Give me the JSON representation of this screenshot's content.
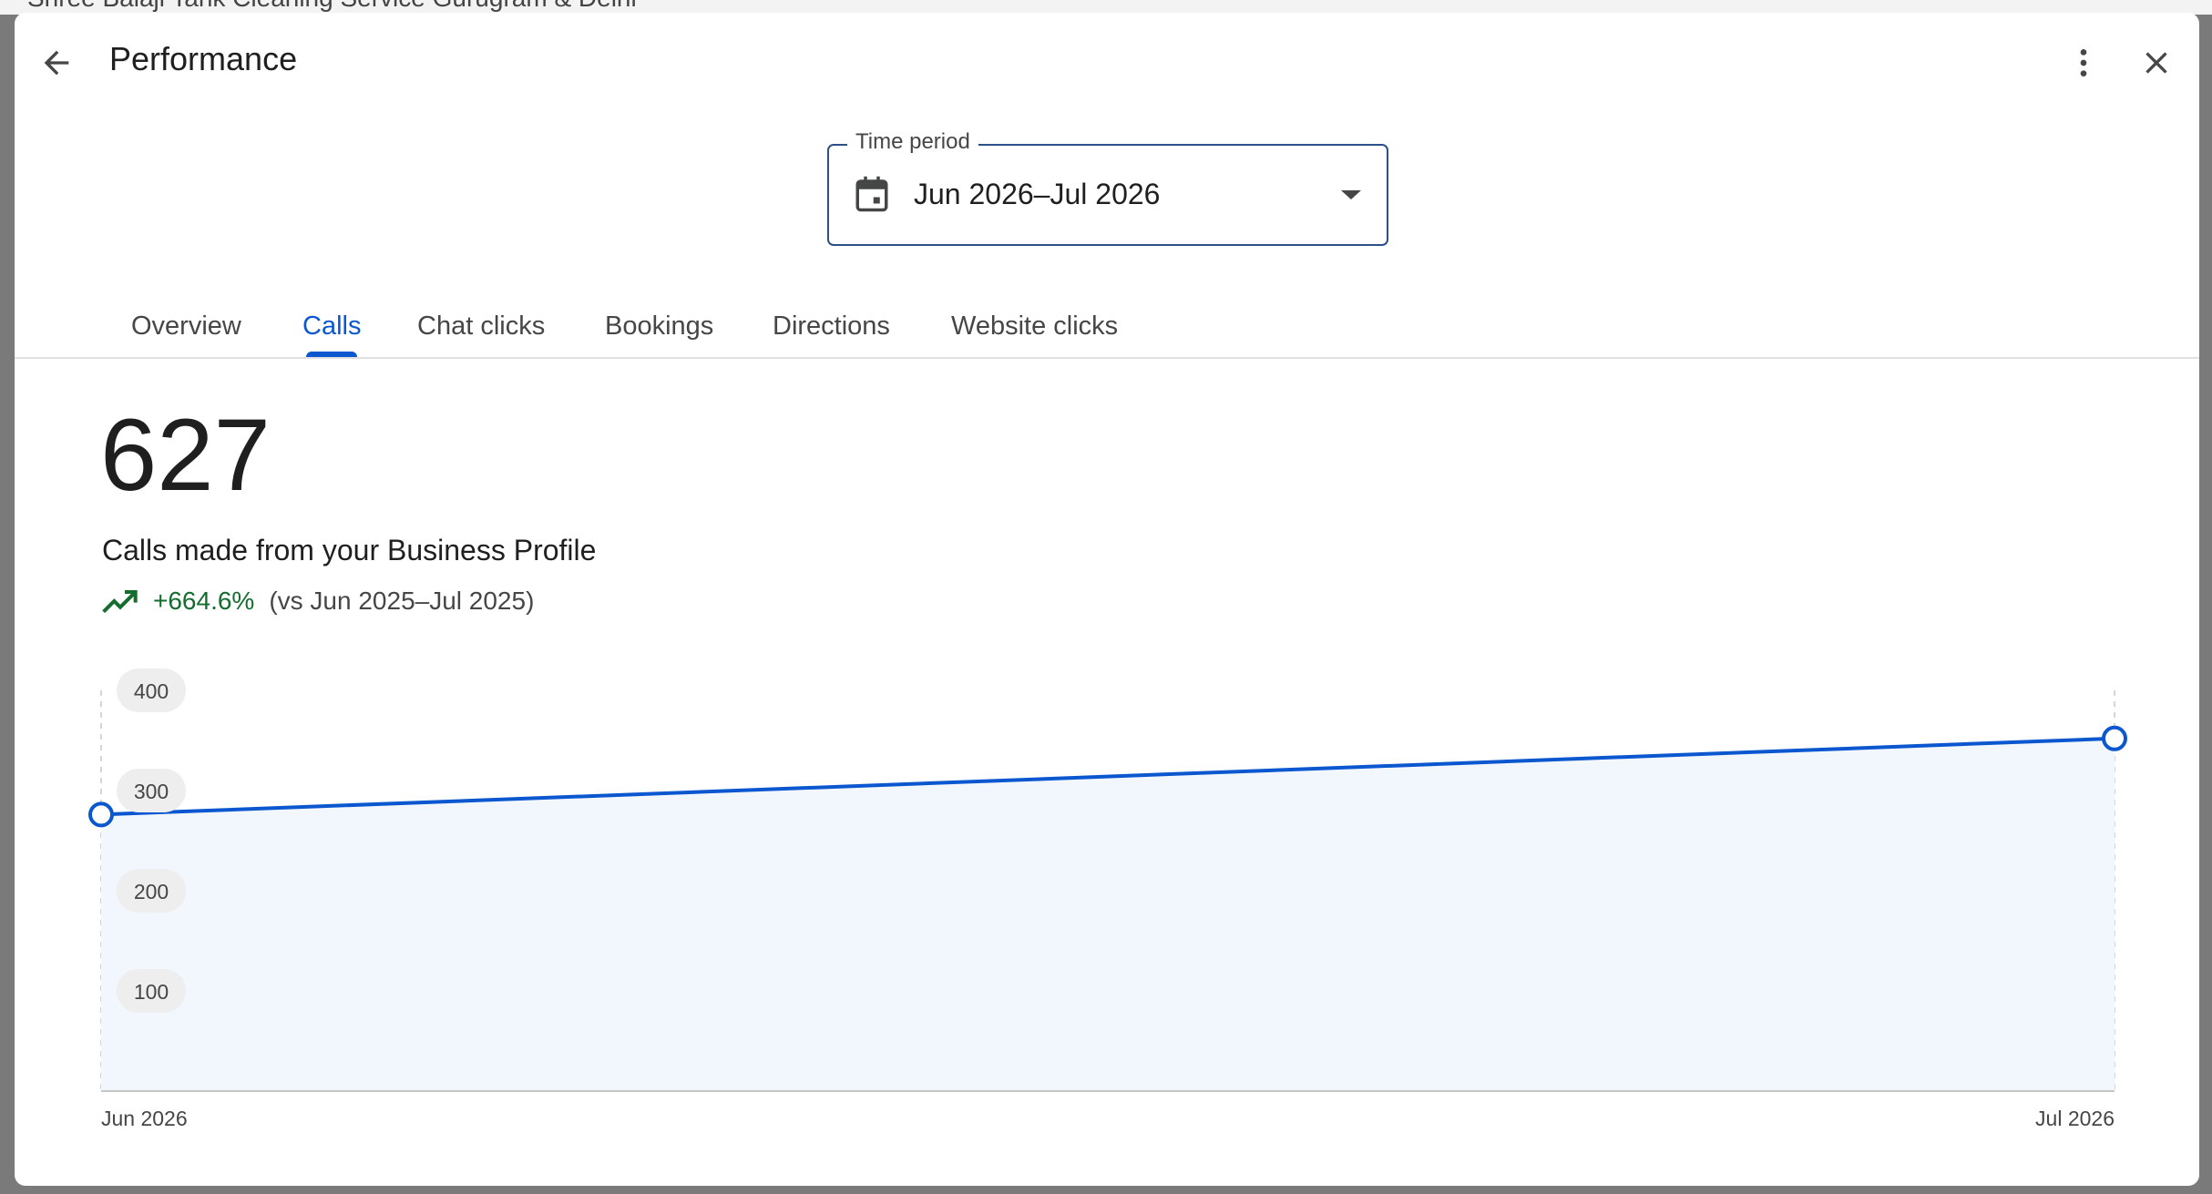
{
  "app": {
    "background_snippet": "Shree Balaji Tank Cleaning Service Gurugram & Delhi"
  },
  "header": {
    "title": "Performance",
    "back_icon": "arrow-back-icon",
    "more_icon": "more-vert-icon",
    "close_icon": "close-icon"
  },
  "time_period": {
    "label": "Time period",
    "value": "Jun 2026–Jul 2026",
    "icon": "calendar-icon"
  },
  "tabs": [
    {
      "label": "Overview",
      "active": false
    },
    {
      "label": "Calls",
      "active": true
    },
    {
      "label": "Chat clicks",
      "active": false
    },
    {
      "label": "Bookings",
      "active": false
    },
    {
      "label": "Directions",
      "active": false
    },
    {
      "label": "Website clicks",
      "active": false
    }
  ],
  "metric": {
    "value": "627",
    "label": "Calls made from your Business Profile",
    "change": "+664.6%",
    "comparison": "(vs Jun 2025–Jul 2025)",
    "trend_icon": "trending-up-icon"
  },
  "colors": {
    "accent": "#0b57d0",
    "positive": "#146c2e",
    "area_fill": "#f2f6fd",
    "field_border": "#2b4f88"
  },
  "chart_data": {
    "type": "area",
    "x": [
      "Jun 2026",
      "Jul 2026"
    ],
    "y": [
      276,
      352
    ],
    "yticks": [
      100,
      200,
      300,
      400
    ],
    "ylim": [
      0,
      400
    ],
    "xlabel": "",
    "ylabel": "",
    "grid": false
  }
}
